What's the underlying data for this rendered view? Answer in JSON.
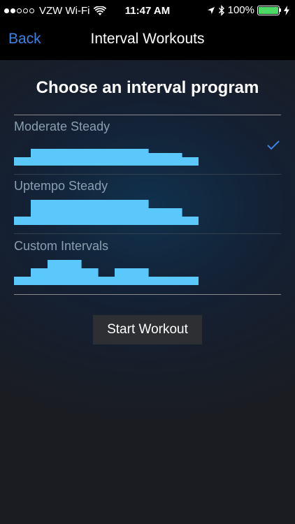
{
  "status_bar": {
    "carrier": "VZW Wi-Fi",
    "time": "11:47 AM",
    "battery": "100%",
    "signal_dots_filled": 2,
    "signal_dots_total": 5,
    "battery_level": 1.0,
    "battery_color": "#4cd964"
  },
  "nav": {
    "back_label": "Back",
    "title": "Interval Workouts"
  },
  "heading": "Choose an interval program",
  "programs": [
    {
      "name": "Moderate Steady",
      "selected": true,
      "intervals": [
        1,
        2,
        2,
        2,
        2,
        2,
        2,
        2,
        1.5,
        1.5,
        1
      ]
    },
    {
      "name": "Uptempo Steady",
      "selected": false,
      "intervals": [
        1,
        3,
        3,
        3,
        3,
        3,
        3,
        3,
        2,
        2,
        1
      ]
    },
    {
      "name": "Custom Intervals",
      "selected": false,
      "intervals": [
        1,
        2,
        3,
        3,
        2,
        1,
        2,
        2,
        1,
        1,
        1
      ]
    }
  ],
  "start_button_label": "Start Workout",
  "colors": {
    "accent": "#3d82e6",
    "chart": "#5ac8fa",
    "program_label": "#8a9fb0"
  }
}
